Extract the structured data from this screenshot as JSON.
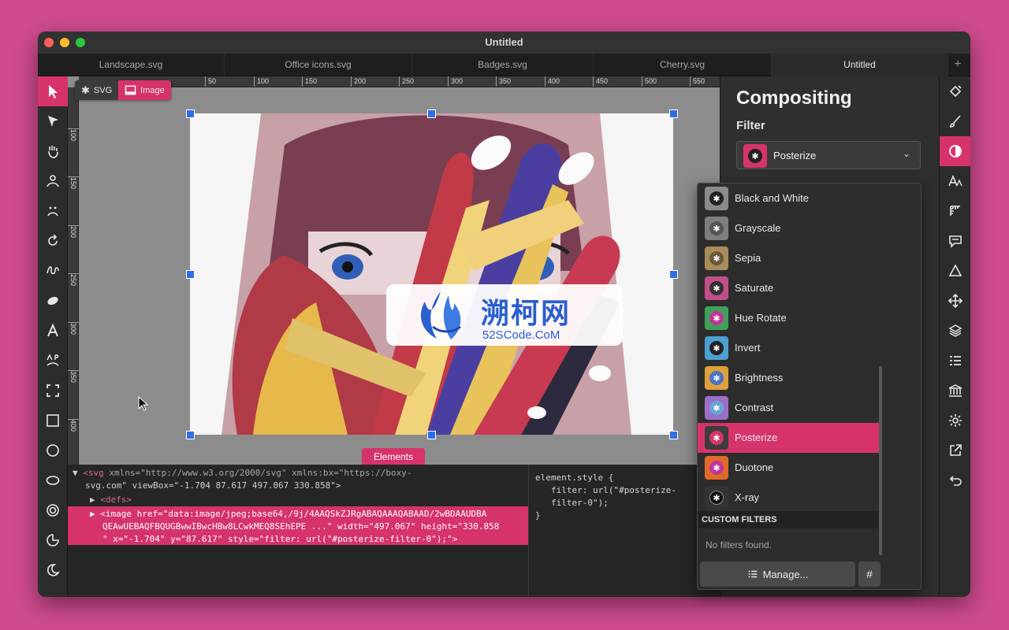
{
  "window": {
    "title": "Untitled"
  },
  "tabs": [
    {
      "label": "Landscape.svg"
    },
    {
      "label": "Office icons.svg"
    },
    {
      "label": "Badges.svg"
    },
    {
      "label": "Cherry.svg"
    },
    {
      "label": "Untitled"
    }
  ],
  "tab_add": "+",
  "mode_switch": {
    "svg_label": "SVG",
    "image_label": "Image"
  },
  "ruler": {
    "h": [
      "50",
      "100",
      "150",
      "200",
      "250",
      "300",
      "350",
      "400",
      "450",
      "500",
      "550"
    ],
    "v": [
      "100",
      "150",
      "200",
      "250",
      "300",
      "350",
      "400"
    ]
  },
  "elements_label": "Elements",
  "code": {
    "line1_tag": "<svg",
    "line1_attrs": " xmlns=\"http://www.w3.org/2000/svg\" xmlns:bx=\"https://boxy-",
    "line2": "svg.com\" viewBox=\"-1.704 87.617 497.067 330.858\">",
    "line3": "<defs>",
    "line4": "<image href=\"data:image/jpeg;base64,/9j/4AAQSkZJRgABAQAAAQABAAD/2wBDAAUDBA",
    "line5": "QEAwUEBAQFBQUGBwwIBwcHBw8LCwkMEQ8SEhEPE ...\" width=\"497.067\" height=\"330.858",
    "line6": "\" x=\"-1.704\" y=\"87.617\" style=\"filter: url(\"#posterize-filter-0\");\">"
  },
  "style_pane": {
    "selector": "element.style {",
    "prop": "filter: url(\"#posterize-",
    "prop2": "filter-0\");",
    "close": "}"
  },
  "panel": {
    "title": "Compositing",
    "subtitle": "Filter",
    "selected_filter": "Posterize",
    "options": [
      {
        "label": "Black and White",
        "color": "#8a8a8a"
      },
      {
        "label": "Grayscale",
        "color": "#7e7e7e"
      },
      {
        "label": "Sepia",
        "color": "#a88c5c"
      },
      {
        "label": "Saturate",
        "color": "#c24e8a"
      },
      {
        "label": "Hue Rotate",
        "color": "#3ea25b"
      },
      {
        "label": "Invert",
        "color": "#4b9fd1"
      },
      {
        "label": "Brightness",
        "color": "#e0a03a"
      },
      {
        "label": "Contrast",
        "color": "#9a6fc8"
      },
      {
        "label": "Posterize",
        "color": "#d6336c"
      },
      {
        "label": "Duotone",
        "color": "#e06a2a"
      },
      {
        "label": "X-ray",
        "color": "#333333"
      }
    ],
    "custom_filters_header": "CUSTOM FILTERS",
    "no_filters": "No filters found.",
    "manage_label": "Manage...",
    "hash_label": "#"
  },
  "watermark": {
    "title": "溯柯网",
    "sub": "52SCode.CoM"
  },
  "colors": {
    "accent": "#d6336c",
    "handle": "#2f6fe6",
    "background": "#cf4b8f"
  }
}
